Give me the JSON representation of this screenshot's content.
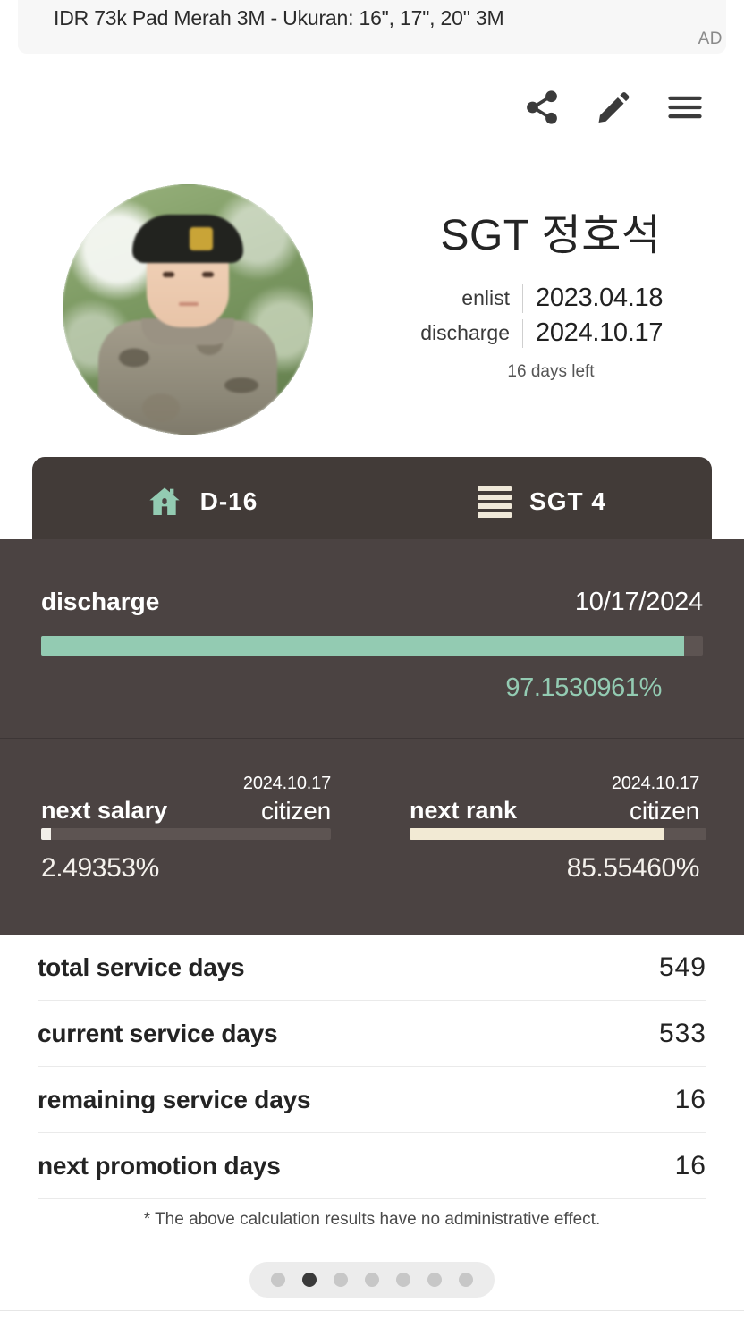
{
  "ad": {
    "text": "IDR 73k Pad Merah 3M - Ukuran: 16\", 17\", 20\" 3M",
    "label": "AD"
  },
  "header": {
    "icons": [
      {
        "name": "share-icon",
        "label": "share"
      },
      {
        "name": "edit-icon",
        "label": "edit"
      },
      {
        "name": "menu-icon",
        "label": "menu"
      }
    ]
  },
  "profile": {
    "avatar_alt": "soldier portrait",
    "name": "SGT 정호석",
    "enlist_label": "enlist",
    "enlist_date": "2023.04.18",
    "discharge_label": "discharge",
    "discharge_date": "2024.10.17",
    "days_left": "16 days left"
  },
  "tabs": [
    {
      "icon": "home-icon",
      "label": "D-16"
    },
    {
      "icon": "rank-stripes-icon",
      "label": "SGT 4"
    }
  ],
  "discharge_card": {
    "label": "discharge",
    "date": "10/17/2024",
    "percent_text": "97.1530961%",
    "percent_value": 97.1530961,
    "bar_color": "#93cbb2"
  },
  "metrics": [
    {
      "name": "next salary",
      "date": "2024.10.17",
      "status": "citizen",
      "percent_text": "2.49353%",
      "percent_value": 2.49353,
      "bar_color": "#f2efe9"
    },
    {
      "name": "next rank",
      "date": "2024.10.17",
      "status": "citizen",
      "percent_text": "85.55460%",
      "percent_value": 85.5546,
      "bar_color": "#f2ead4"
    }
  ],
  "stats": [
    {
      "label": "total service days",
      "value": "549"
    },
    {
      "label": "current service days",
      "value": "533"
    },
    {
      "label": "remaining service days",
      "value": "16"
    },
    {
      "label": "next promotion days",
      "value": "16"
    }
  ],
  "footnote": "* The above calculation results have no administrative effect.",
  "pagination": {
    "count": 7,
    "active_index": 1
  },
  "colors": {
    "panel_dark": "#4b4342",
    "tab_dark": "#423b38",
    "mint": "#93cbb2",
    "cream": "#f2ead4"
  }
}
